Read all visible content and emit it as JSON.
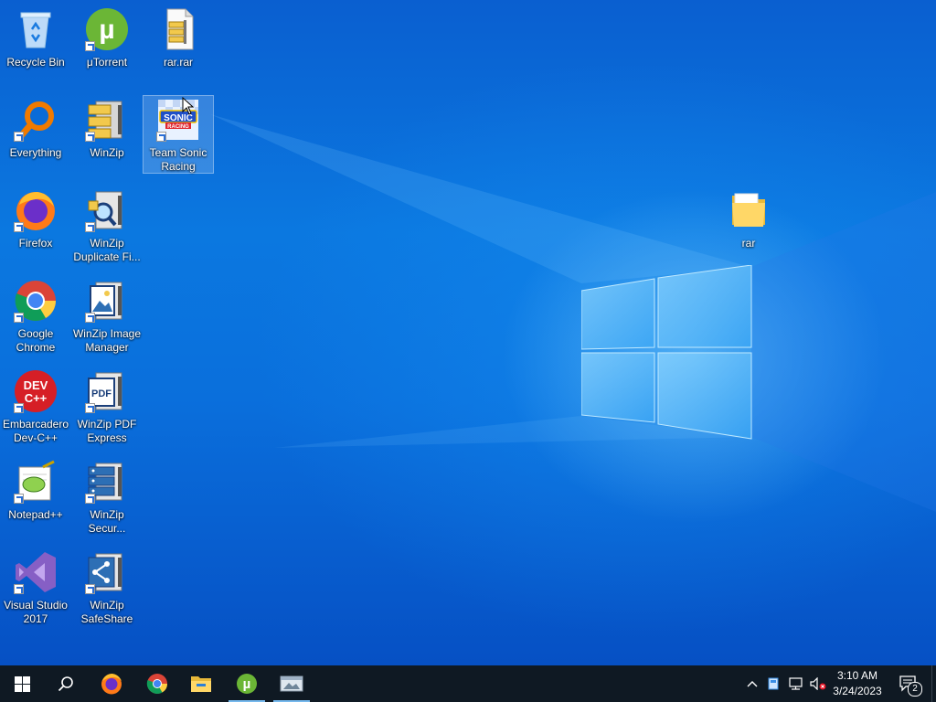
{
  "desktop": {
    "icons": [
      {
        "label": "Recycle Bin"
      },
      {
        "label": "μTorrent"
      },
      {
        "label": "rar.rar"
      },
      {
        "label": "Everything"
      },
      {
        "label": "WinZip"
      },
      {
        "label": "Team Sonic Racing"
      },
      {
        "label": "Firefox"
      },
      {
        "label": "WinZip Duplicate Fi..."
      },
      {
        "label": "Google Chrome"
      },
      {
        "label": "WinZip Image Manager"
      },
      {
        "label": "Embarcadero Dev-C++"
      },
      {
        "label": "WinZip PDF Express"
      },
      {
        "label": "Notepad++"
      },
      {
        "label": "WinZip Secur..."
      },
      {
        "label": "Visual Studio 2017"
      },
      {
        "label": "WinZip SafeShare"
      },
      {
        "label": "rar"
      }
    ]
  },
  "taskbar": {
    "clock_time": "3:10 AM",
    "clock_date": "3/24/2023",
    "notification_count": "2"
  },
  "colors": {
    "accent": "#0a6fdc",
    "taskbar": "#0f1923",
    "active_indicator": "#76b9ed"
  }
}
